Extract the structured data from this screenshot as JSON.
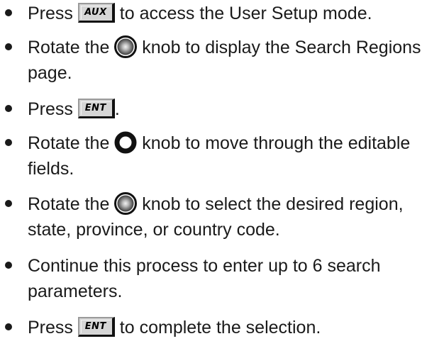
{
  "icons": {
    "bullet": "bullet-dot",
    "knob_large": "large-knob-icon",
    "knob_ring": "ring-knob-icon"
  },
  "steps": [
    {
      "before": "Press ",
      "key": "AUX",
      "after": " to access the User Setup mode."
    },
    {
      "line1_before": "Rotate the ",
      "line1_after": " knob to display the Search Regions",
      "line2": "page."
    },
    {
      "before": "Press ",
      "key": "ENT",
      "after": "."
    },
    {
      "line1_before": "Rotate the ",
      "line1_after": " knob to move through the editable",
      "line2": "fields."
    },
    {
      "line1_before": "Rotate the ",
      "line1_after": " knob to select the desired region,",
      "line2": "state, province, or country code."
    },
    {
      "line1": "Continue this process to enter up to 6 search",
      "line2": "parameters."
    },
    {
      "before": "Press ",
      "key": "ENT",
      "after": " to complete the selection."
    }
  ]
}
